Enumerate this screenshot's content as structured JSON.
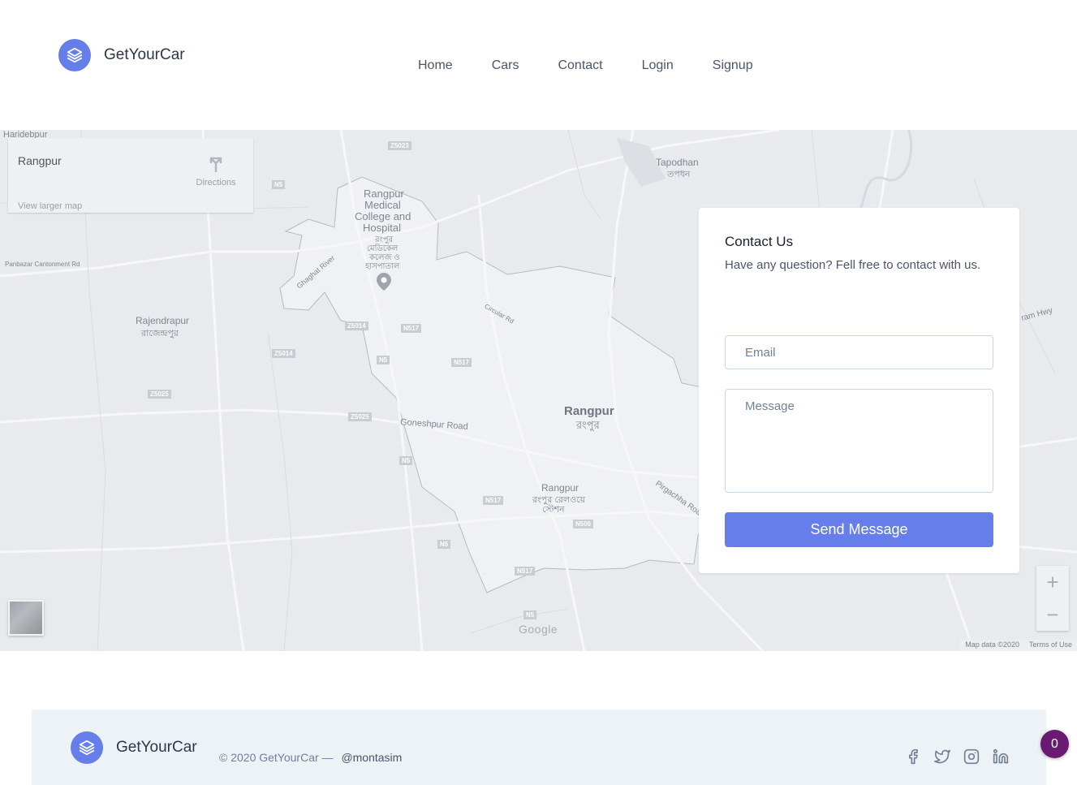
{
  "brand": {
    "name": "GetYourCar",
    "accent": "#667eea"
  },
  "nav": {
    "items": [
      "Home",
      "Cars",
      "Contact",
      "Login",
      "Signup"
    ]
  },
  "map": {
    "place_title": "Rangpur",
    "directions": "Directions",
    "view_larger": "View larger map",
    "zoom_in": "+",
    "zoom_out": "−",
    "logo": "Google",
    "map_data": "Map data ©2020",
    "terms": "Terms of Use",
    "labels": {
      "haridebpur": "Haridebpur",
      "tapodhan": "Tapodhan",
      "tapodhan_bn": "তপধন",
      "hospital_1": "Rangpur",
      "hospital_2": "Medical",
      "hospital_3": "College and",
      "hospital_4": "Hospital",
      "hospital_bn1": "রংপুর",
      "hospital_bn2": "মেডিকেল",
      "hospital_bn3": "কলেজ ও",
      "hospital_bn4": "হাসপাতাল",
      "rajendrapur": "Rajendrapur",
      "rajendrapur_bn": "রাজেন্দ্রপুর",
      "rangpur": "Rangpur",
      "rangpur_bn": "রংপুর",
      "station": "Rangpur",
      "station_bn": "রংপুর রেলওয়ে",
      "station_bn2": "স্টেশন",
      "goneshpur": "Goneshpur Road",
      "panbazar": "Panbazar Cantonment Rd",
      "ghaghat": "Ghaghat River",
      "pirgachha": "Pirgachha Road",
      "circular": "Circular Rd",
      "ram_hwy": "ram Hwy"
    },
    "shields": [
      "Z5023",
      "N5",
      "Z5014",
      "N517",
      "Z5014",
      "N5",
      "N517",
      "Z5025",
      "Z5025",
      "N5",
      "N517",
      "N506",
      "N5",
      "N517",
      "N5"
    ]
  },
  "contact": {
    "title": "Contact Us",
    "subtitle": "Have any question? Fell free to contact with us.",
    "email_placeholder": "Email",
    "message_placeholder": "Message",
    "send": "Send Message"
  },
  "footer": {
    "brand": "GetYourCar",
    "copyright": "© 2020 GetYourCar —",
    "handle": "@montasim",
    "social": [
      "facebook-icon",
      "twitter-icon",
      "instagram-icon",
      "linkedin-icon"
    ]
  },
  "badge": {
    "count": "0"
  }
}
